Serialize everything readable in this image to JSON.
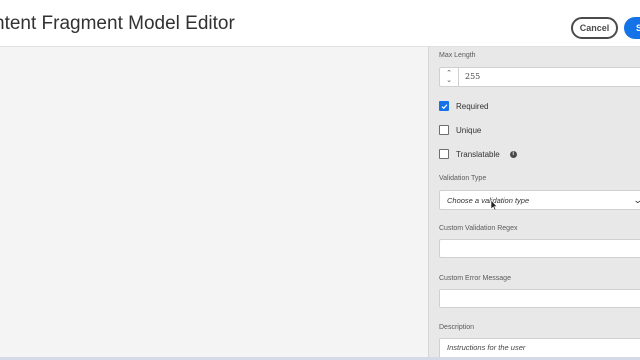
{
  "header": {
    "title": "ntent Fragment Model Editor",
    "cancel_label": "Cancel",
    "save_label": "S"
  },
  "properties": {
    "max_length": {
      "label": "Max Length",
      "value": "255"
    },
    "required": {
      "label": "Required",
      "checked": true
    },
    "unique": {
      "label": "Unique",
      "checked": false
    },
    "translatable": {
      "label": "Translatable",
      "checked": false,
      "info_icon": "info-icon"
    },
    "validation_type": {
      "label": "Validation Type",
      "placeholder": "Choose a validation type"
    },
    "custom_regex": {
      "label": "Custom Validation Regex",
      "value": ""
    },
    "custom_error": {
      "label": "Custom Error Message",
      "value": ""
    },
    "description": {
      "label": "Description",
      "placeholder": "Instructions for the user"
    }
  },
  "colors": {
    "accent": "#1473e6",
    "panel_bg": "#e8e8e8",
    "canvas_bg": "#f4f4f4"
  }
}
